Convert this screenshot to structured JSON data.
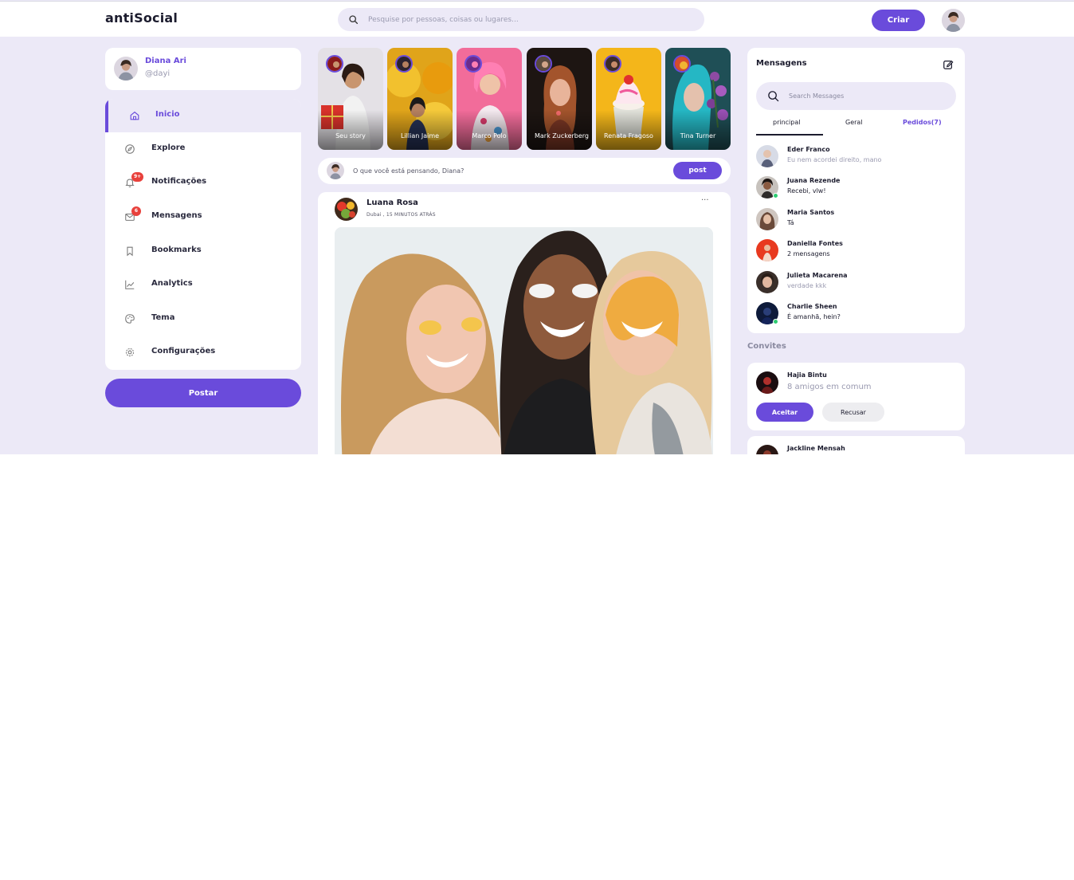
{
  "nav": {
    "logo": "antiSocial",
    "search_placeholder": "Pesquise por pessoas, coisas ou lugares...",
    "create_label": "Criar"
  },
  "profile": {
    "name": "Diana Ari",
    "handle": "@dayi"
  },
  "sidebar": {
    "items": [
      {
        "label": "Inicio",
        "icon": "home-icon",
        "active": true
      },
      {
        "label": "Explore",
        "icon": "compass-icon"
      },
      {
        "label": "Notificações",
        "icon": "bell-icon",
        "badge": "9+"
      },
      {
        "label": "Mensagens",
        "icon": "mail-icon",
        "badge": "6"
      },
      {
        "label": "Bookmarks",
        "icon": "bookmark-icon"
      },
      {
        "label": "Analytics",
        "icon": "chart-line-icon"
      },
      {
        "label": "Tema",
        "icon": "palette-icon"
      },
      {
        "label": "Configurações",
        "icon": "gear-icon"
      }
    ],
    "post_button": "Postar"
  },
  "stories": [
    {
      "name": "Seu story"
    },
    {
      "name": "Lillian Jaime"
    },
    {
      "name": "Marco Polo"
    },
    {
      "name": "Mark Zuckerberg"
    },
    {
      "name": "Renata Fragoso"
    },
    {
      "name": "Tina Turner"
    }
  ],
  "composer": {
    "placeholder": "O que você está pensando, Diana?",
    "button": "post"
  },
  "feed": {
    "author": "Luana Rosa",
    "meta": "Dubai , 15 MINUTOS ATRÁS",
    "more": "···"
  },
  "messages": {
    "title": "Mensagens",
    "search_placeholder": "Search Messages",
    "tabs": [
      "principal",
      "Geral",
      "Pedidos(7)"
    ],
    "items": [
      {
        "name": "Eder Franco",
        "text": "Eu nem acordei direito, mano",
        "muted": true,
        "online": false
      },
      {
        "name": "Juana Rezende",
        "text": "Recebi, vlw!",
        "muted": false,
        "online": true
      },
      {
        "name": "Maria Santos",
        "text": "Tá",
        "muted": false,
        "online": false
      },
      {
        "name": "Daniella Fontes",
        "text": "2 mensagens",
        "muted": false,
        "online": false
      },
      {
        "name": "Julieta Macarena",
        "text": "verdade kkk",
        "muted": true,
        "online": false
      },
      {
        "name": "Charlie Sheen",
        "text": "É amanhã, hein?",
        "muted": false,
        "online": true
      }
    ]
  },
  "invites": {
    "title": "Convites",
    "items": [
      {
        "name": "Hajia Bintu",
        "mutual": "8 amigos em comum",
        "accept": "Aceitar",
        "decline": "Recusar"
      },
      {
        "name": "Jackline Mensah"
      }
    ]
  },
  "colors": {
    "accent": "#6a4bdb",
    "background": "#ece9f7",
    "badge": "#e8413c",
    "online": "#2ecc71"
  }
}
